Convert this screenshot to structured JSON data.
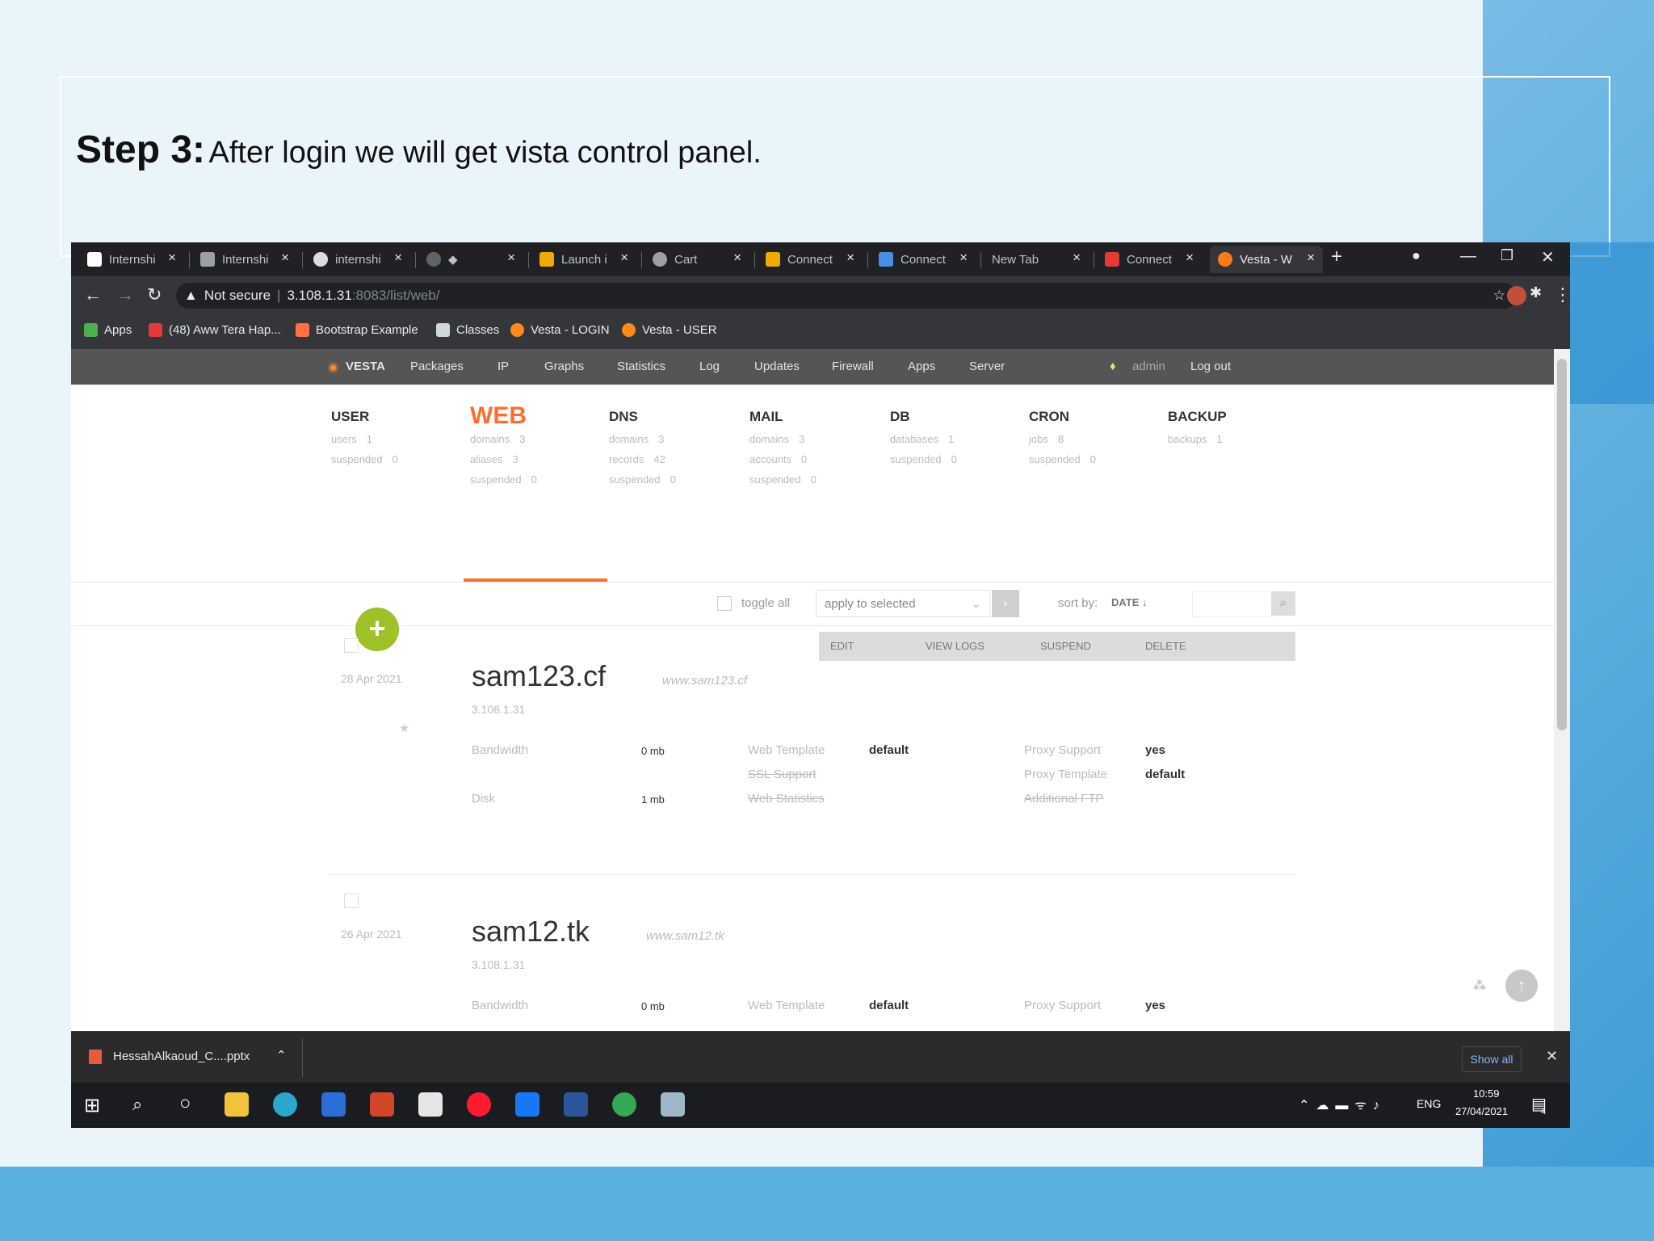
{
  "slide": {
    "step_label": "Step 3:",
    "step_text": "After login we will get vista control panel."
  },
  "browser": {
    "tabs": [
      {
        "label": "Internshi",
        "color": "#ffffff"
      },
      {
        "label": "Internshi",
        "color": "#9aa0a6"
      },
      {
        "label": "internshi",
        "color": "#dcdcdc"
      },
      {
        "label": "◆",
        "color": "#5f6368"
      },
      {
        "label": "Launch i",
        "color": "#f2a900"
      },
      {
        "label": "Cart",
        "color": "#9aa0a6"
      },
      {
        "label": "Connect",
        "color": "#f2a900"
      },
      {
        "label": "Connect",
        "color": "#4a90e2"
      },
      {
        "label": "New Tab",
        "color": ""
      },
      {
        "label": "Connect",
        "color": "#e53935"
      },
      {
        "label": "Vesta - W",
        "color": "#ff7a1a"
      }
    ],
    "new_tab_symbol": "+",
    "close_symbol": "×",
    "security_label": "Not secure",
    "url_host": "3.108.1.31",
    "url_path": ":8083/list/web/",
    "bookmarks": [
      {
        "label": "Apps",
        "color": "#4caf50"
      },
      {
        "label": "(48) Aww Tera Hap...",
        "color": "#e53935"
      },
      {
        "label": "Bootstrap Example",
        "color": "#ff7043"
      },
      {
        "label": "Classes",
        "color": "#cfd8dc"
      },
      {
        "label": "Vesta - LOGIN",
        "color": "#ff8a1a"
      },
      {
        "label": "Vesta - USER",
        "color": "#ff8a1a"
      }
    ]
  },
  "vesta": {
    "logo": "VESTA",
    "nav": [
      "Packages",
      "IP",
      "Graphs",
      "Statistics",
      "Log",
      "Updates",
      "Firewall",
      "Apps",
      "Server"
    ],
    "user": "admin",
    "logout": "Log out",
    "stats": [
      {
        "title": "USER",
        "rows": [
          [
            "users",
            "1"
          ],
          [
            "suspended",
            "0"
          ]
        ]
      },
      {
        "title": "WEB",
        "rows": [
          [
            "domains",
            "3"
          ],
          [
            "aliases",
            "3"
          ],
          [
            "suspended",
            "0"
          ]
        ]
      },
      {
        "title": "DNS",
        "rows": [
          [
            "domains",
            "3"
          ],
          [
            "records",
            "42"
          ],
          [
            "suspended",
            "0"
          ]
        ]
      },
      {
        "title": "MAIL",
        "rows": [
          [
            "domains",
            "3"
          ],
          [
            "accounts",
            "0"
          ],
          [
            "suspended",
            "0"
          ]
        ]
      },
      {
        "title": "DB",
        "rows": [
          [
            "databases",
            "1"
          ],
          [
            "suspended",
            "0"
          ]
        ]
      },
      {
        "title": "CRON",
        "rows": [
          [
            "jobs",
            "8"
          ],
          [
            "suspended",
            "0"
          ]
        ]
      },
      {
        "title": "BACKUP",
        "rows": [
          [
            "backups",
            "1"
          ]
        ]
      }
    ],
    "toolbar": {
      "toggle_all": "toggle all",
      "apply_selected": "apply to selected",
      "sort_label": "sort by:",
      "sort_value": "DATE ↓"
    },
    "actions": [
      "EDIT",
      "VIEW LOGS",
      "SUSPEND",
      "DELETE"
    ],
    "domains": [
      {
        "date": "28 Apr 2021",
        "name": "sam123.cf",
        "alias": "www.sam123.cf",
        "ip": "3.108.1.31",
        "bandwidth_label": "Bandwidth",
        "bandwidth": "0 mb",
        "disk_label": "Disk",
        "disk": "1 mb",
        "web_template_label": "Web Template",
        "web_template": "default",
        "ssl_label": "SSL Support",
        "web_stats_label": "Web Statistics",
        "proxy_support_label": "Proxy Support",
        "proxy_support": "yes",
        "proxy_template_label": "Proxy Template",
        "proxy_template": "default",
        "ftp_label": "Additional FTP"
      },
      {
        "date": "26 Apr 2021",
        "name": "sam12.tk",
        "alias": "www.sam12.tk",
        "ip": "3.108.1.31",
        "bandwidth_label": "Bandwidth",
        "bandwidth": "0 mb",
        "web_template_label": "Web Template",
        "web_template": "default",
        "proxy_support_label": "Proxy Support",
        "proxy_support": "yes"
      }
    ]
  },
  "download": {
    "file": "HessahAlkaoud_C....pptx",
    "show_all": "Show all"
  },
  "taskbar": {
    "lang": "ENG",
    "time": "10:59",
    "date": "27/04/2021",
    "notif_count": "4"
  }
}
